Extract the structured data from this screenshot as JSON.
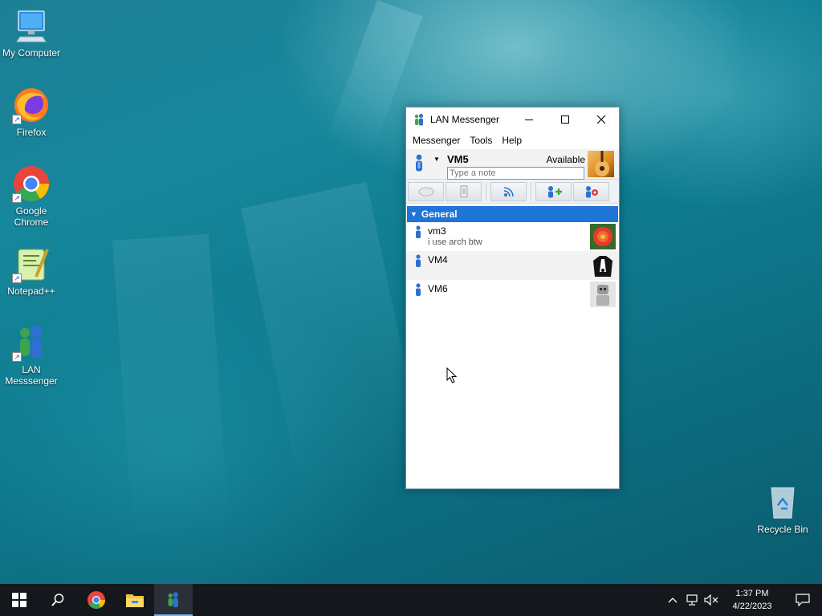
{
  "desktop": {
    "icons": [
      {
        "label": "My Computer",
        "icon": "computer-icon"
      },
      {
        "label": "Firefox",
        "icon": "firefox-icon"
      },
      {
        "label": "Google Chrome",
        "icon": "chrome-icon"
      },
      {
        "label": "Notepad++",
        "icon": "notepad-plus-plus-icon"
      },
      {
        "label": "LAN Messsenger",
        "icon": "lan-messenger-icon"
      },
      {
        "label": "Recycle Bin",
        "icon": "recycle-bin-icon"
      }
    ]
  },
  "window": {
    "title": "LAN Messenger",
    "menu": [
      "Messenger",
      "Tools",
      "Help"
    ],
    "profile": {
      "name": "VM5",
      "status": "Available",
      "note_placeholder": "Type a note"
    },
    "toolbar": [
      {
        "icon": "chat-bubble-icon"
      },
      {
        "icon": "send-file-icon"
      },
      {
        "icon": "broadcast-icon"
      },
      {
        "icon": "add-contact-icon"
      },
      {
        "icon": "settings-people-icon"
      }
    ],
    "group": {
      "name": "General"
    },
    "contacts": [
      {
        "name": "vm3",
        "note": "i use arch btw",
        "avatar": "flower-avatar"
      },
      {
        "name": "VM4",
        "note": "",
        "avatar": "dog-avatar"
      },
      {
        "name": "VM6",
        "note": "",
        "avatar": "robot-avatar"
      }
    ]
  },
  "taskbar": {
    "apps": [
      {
        "icon": "windows-start-icon"
      },
      {
        "icon": "search-icon"
      },
      {
        "icon": "chrome-icon"
      },
      {
        "icon": "file-explorer-icon"
      },
      {
        "icon": "lan-messenger-icon"
      }
    ],
    "tray": {
      "time": "1:37 PM",
      "date": "4/22/2023"
    }
  },
  "colors": {
    "group_header": "#1f74d8",
    "taskbar": "#14171b",
    "note_border": "#5c9fd6"
  }
}
